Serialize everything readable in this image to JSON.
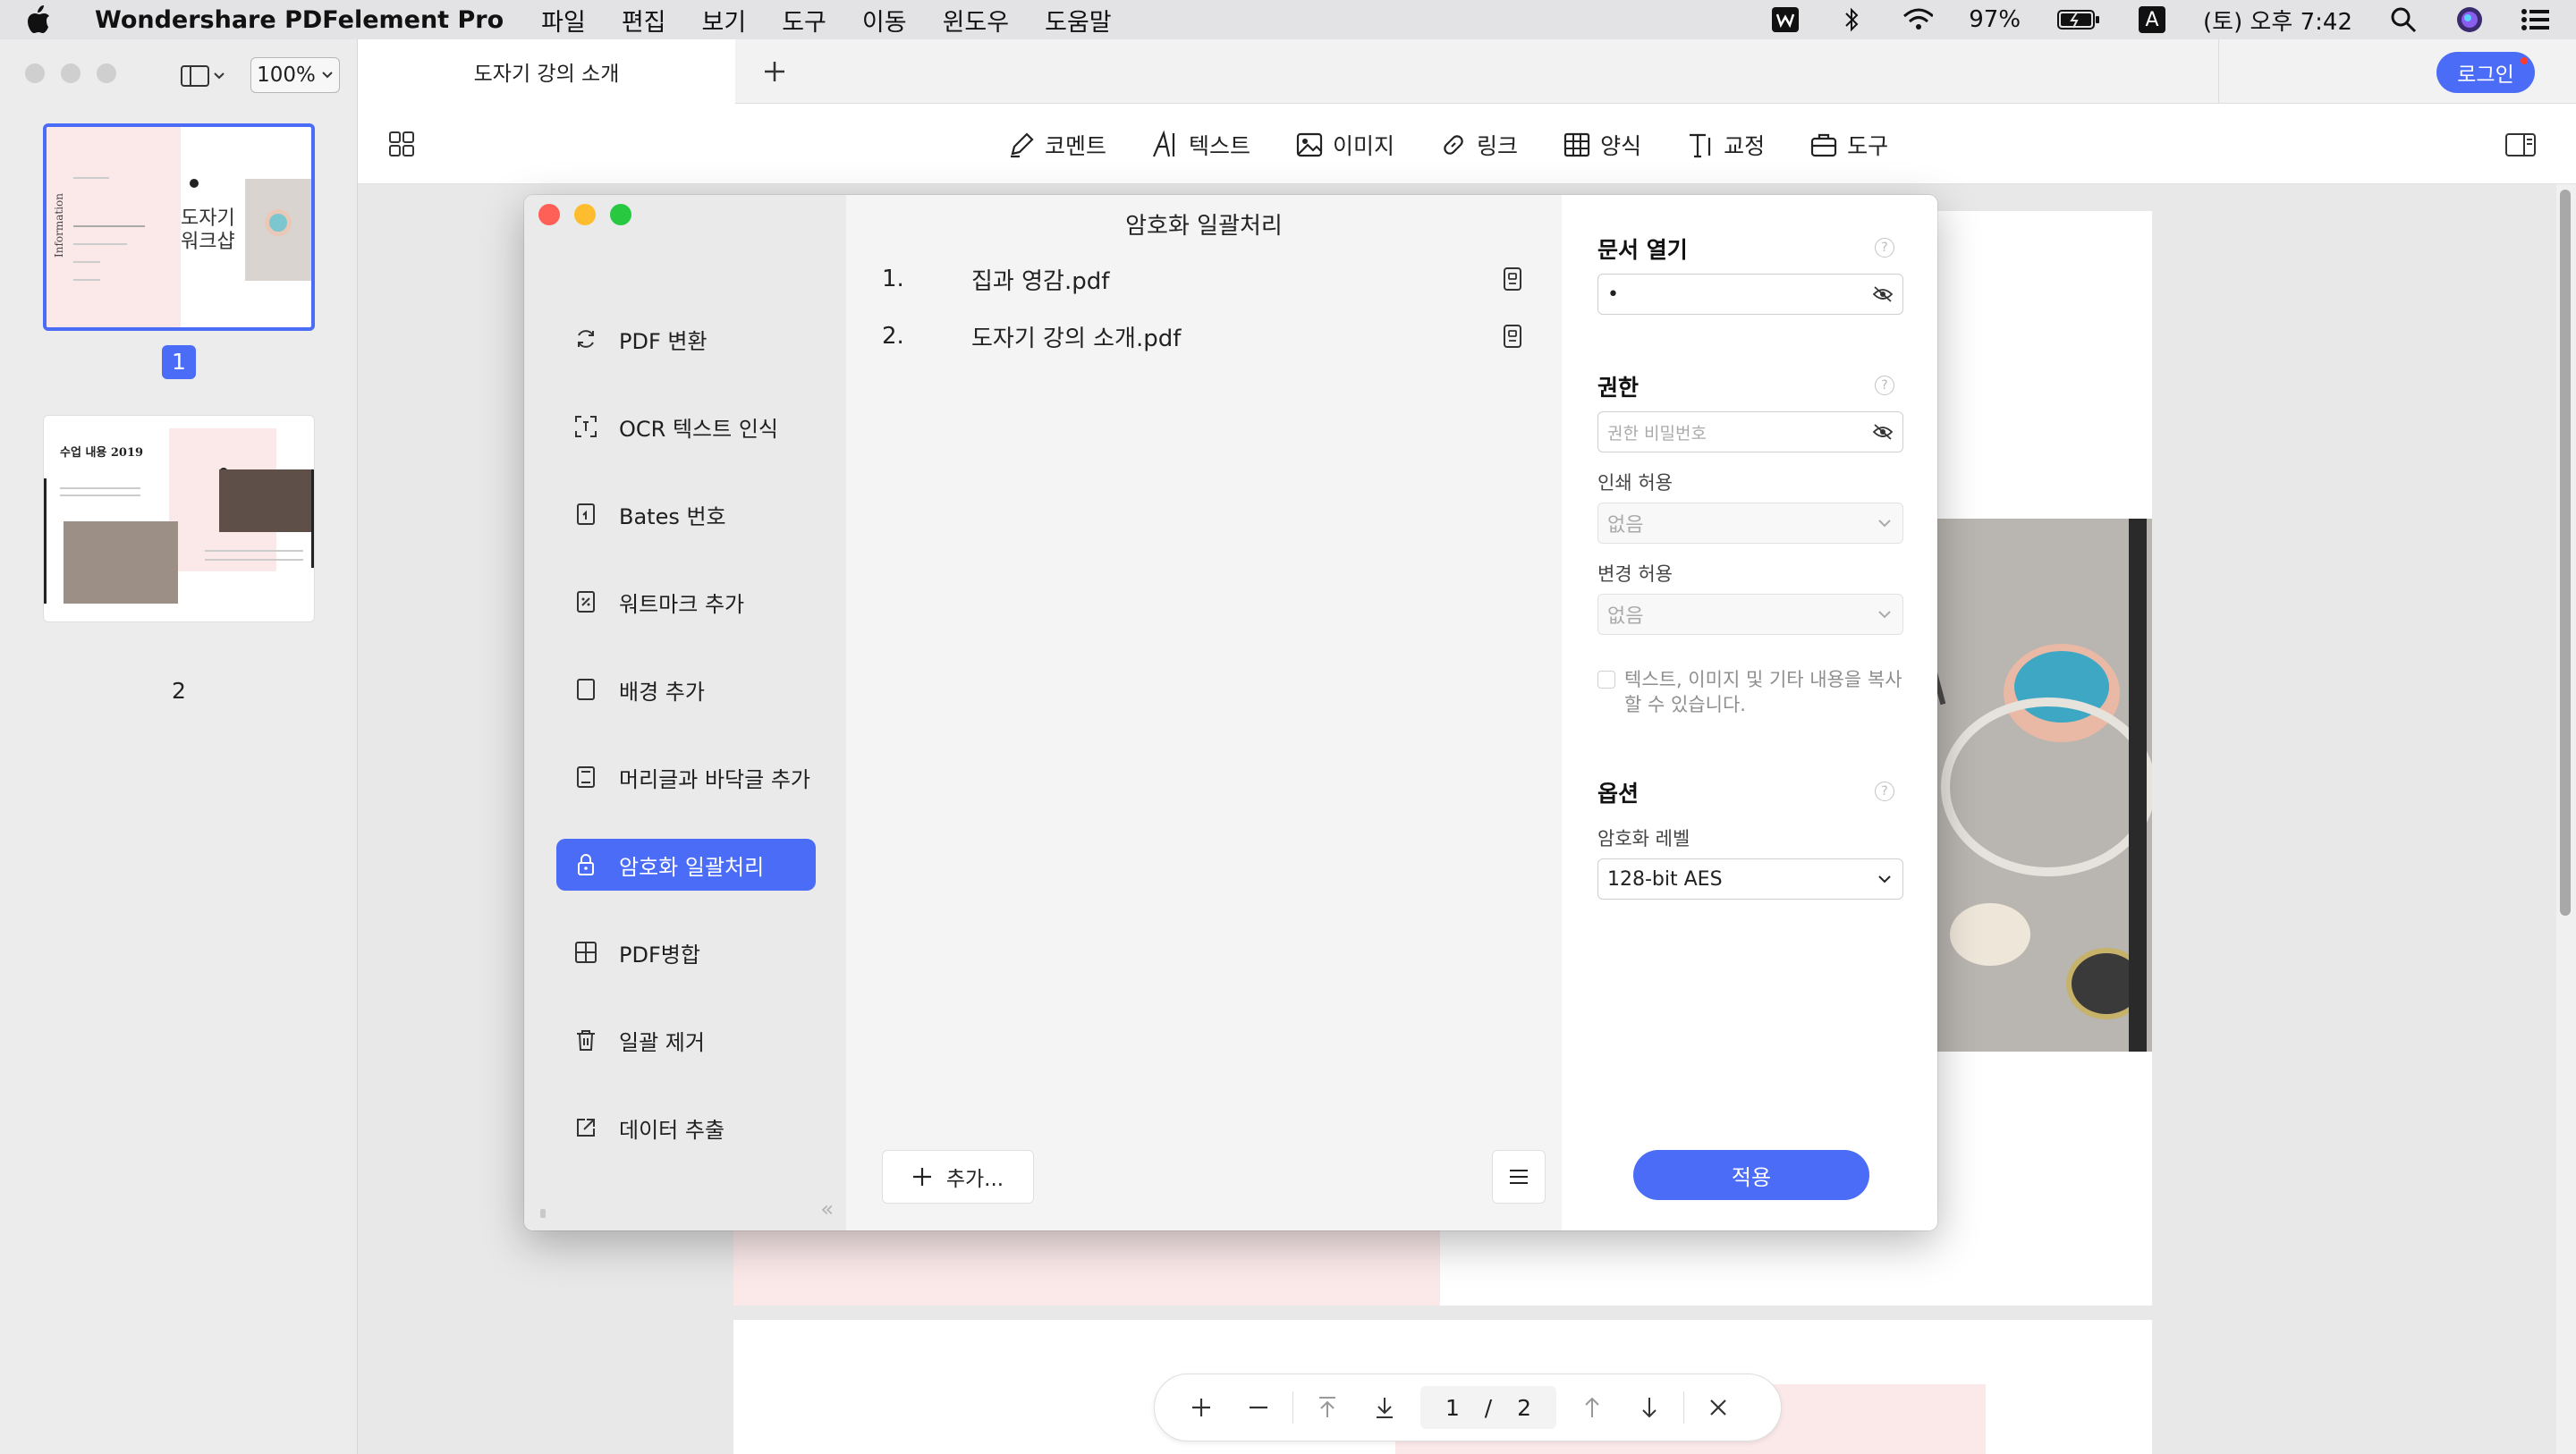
{
  "menubar": {
    "app_name": "Wondershare PDFelement Pro",
    "items": [
      "파일",
      "편집",
      "보기",
      "도구",
      "이동",
      "윈도우",
      "도움말"
    ],
    "battery": "97%",
    "input_source": "A",
    "clock": "(토) 오후 7:42"
  },
  "sidebar": {
    "zoom": "100%",
    "pages": [
      "1",
      "2"
    ],
    "thumb1": {
      "tag": "Information",
      "title_line1": "도자기",
      "title_line2": "워크샵"
    },
    "thumb2": {
      "title": "수업 내용 2019"
    }
  },
  "tabs": {
    "active_tab": "도자기 강의 소개",
    "login": "로그인"
  },
  "toolbar": {
    "tools": [
      {
        "label": "코멘트",
        "icon": "pen-icon"
      },
      {
        "label": "텍스트",
        "icon": "text-icon"
      },
      {
        "label": "이미지",
        "icon": "image-icon"
      },
      {
        "label": "링크",
        "icon": "link-icon"
      },
      {
        "label": "양식",
        "icon": "table-icon"
      },
      {
        "label": "교정",
        "icon": "redact-icon"
      },
      {
        "label": "도구",
        "icon": "toolbox-icon"
      }
    ]
  },
  "pager": {
    "current": "1",
    "separator": "/",
    "total": "2"
  },
  "dialog": {
    "title": "암호화 일괄처리",
    "nav": [
      {
        "label": "PDF 변환",
        "icon": "convert-icon"
      },
      {
        "label": "OCR 텍스트 인식",
        "icon": "ocr-icon"
      },
      {
        "label": "Bates 번호",
        "icon": "bates-icon"
      },
      {
        "label": "워트마크 추가",
        "icon": "watermark-icon"
      },
      {
        "label": "배경 추가",
        "icon": "background-icon"
      },
      {
        "label": "머리글과 바닥글 추가",
        "icon": "header-footer-icon"
      },
      {
        "label": "암호화 일괄처리",
        "icon": "lock-icon"
      },
      {
        "label": "PDF병합",
        "icon": "merge-icon"
      },
      {
        "label": "일괄 제거",
        "icon": "trash-icon"
      },
      {
        "label": "데이터 추출",
        "icon": "export-icon"
      }
    ],
    "active_index": 6,
    "files": [
      {
        "index": "1.",
        "name": "집과 영감.pdf"
      },
      {
        "index": "2.",
        "name": "도자기 강의 소개.pdf"
      }
    ],
    "add_label": "추가...",
    "right": {
      "open_doc_title": "문서 열기",
      "open_password_value": "•",
      "permission_title": "권한",
      "permission_placeholder": "권한 비밀번호",
      "print_label": "인쇄 허용",
      "print_value": "없음",
      "change_label": "변경 허용",
      "change_value": "없음",
      "copy_checkbox_label": "텍스트, 이미지 및 기타 내용을 복사할 수 있습니다.",
      "options_title": "옵션",
      "encryption_label": "암호화 레벨",
      "encryption_value": "128-bit AES",
      "apply": "적용"
    }
  },
  "colors": {
    "accent": "#4a6cf7",
    "traffic_red": "#fe5f57",
    "traffic_yellow": "#febc2e",
    "traffic_green": "#28c840"
  }
}
